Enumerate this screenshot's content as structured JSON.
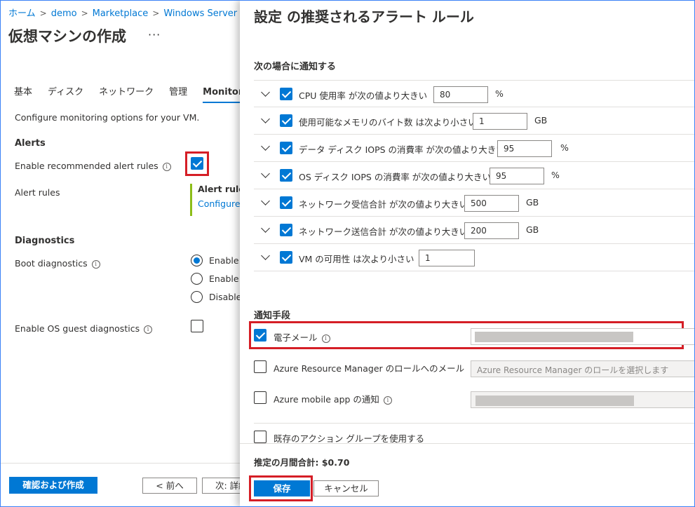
{
  "breadcrumb": [
    "ホーム",
    "demo",
    "Marketplace",
    "Windows Server"
  ],
  "page": {
    "title": "仮想マシンの作成",
    "more": "···"
  },
  "tabs": [
    "基本",
    "ディスク",
    "ネットワーク",
    "管理",
    "Monitoring"
  ],
  "monitoring": {
    "description": "Configure monitoring options for your VM.",
    "alerts_heading": "Alerts",
    "enable_alerts_label": "Enable recommended alert rules",
    "alert_rules_label": "Alert rules",
    "alert_rules_title": "Alert rules",
    "alert_rules_link": "Configure",
    "diagnostics_heading": "Diagnostics",
    "boot_diag_label": "Boot diagnostics",
    "boot_options": [
      "Enable with managed storage account (recommended)",
      "Enable with custom storage account",
      "Disable"
    ],
    "os_guest_label": "Enable OS guest diagnostics"
  },
  "left_footer": {
    "review_create": "確認および作成",
    "prev": "< 前へ",
    "next": "次: 詳細 >"
  },
  "flyout": {
    "title": "設定 の推奨されるアラート ルール",
    "notify_heading": "次の場合に通知する",
    "rules": [
      {
        "label": "CPU 使用率 が次の値より大きい",
        "value": "80",
        "unit": "%"
      },
      {
        "label": "使用可能なメモリのバイト数 は次より小さい",
        "value": "1",
        "unit": "GB"
      },
      {
        "label": "データ ディスク IOPS の消費率 が次の値より大きい",
        "value": "95",
        "unit": "%"
      },
      {
        "label": "OS ディスク IOPS の消費率 が次の値より大きい",
        "value": "95",
        "unit": "%"
      },
      {
        "label": "ネットワーク受信合計 が次の値より大きい",
        "value": "500",
        "unit": "GB"
      },
      {
        "label": "ネットワーク送信合計 が次の値より大きい",
        "value": "200",
        "unit": "GB"
      },
      {
        "label": "VM の可用性 は次より小さい",
        "value": "1",
        "unit": ""
      }
    ],
    "notify_method_heading": "通知手段",
    "email_label": "電子メール",
    "arm_role_label": "Azure Resource Manager のロールへのメール",
    "arm_role_placeholder": "Azure Resource Manager のロールを選択します",
    "mobile_app_label": "Azure mobile app の通知",
    "action_group_label": "既存のアクション グループを使用する",
    "cost": "推定の月間合計: $0.70",
    "save": "保存",
    "cancel": "キャンセル"
  },
  "colors": {
    "accent": "#0078d4",
    "highlight": "#d51e26",
    "alert_bar": "#8cbd18"
  }
}
